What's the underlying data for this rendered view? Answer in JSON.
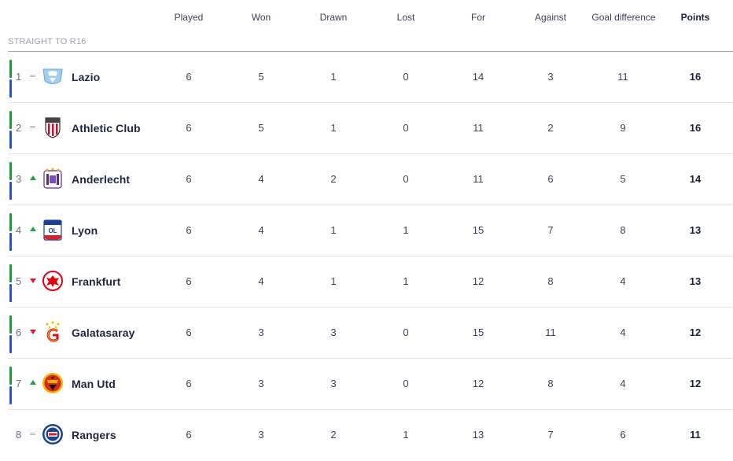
{
  "headers": {
    "played": "Played",
    "won": "Won",
    "drawn": "Drawn",
    "lost": "Lost",
    "for": "For",
    "against": "Against",
    "goal_difference": "Goal difference",
    "points": "Points"
  },
  "section_label": "STRAIGHT TO R16",
  "rows": [
    {
      "pos": "1",
      "move": "same",
      "team": "Lazio",
      "crest": "lazio-crest-icon",
      "played": "6",
      "won": "5",
      "drawn": "1",
      "lost": "0",
      "for": "14",
      "against": "3",
      "gd": "11",
      "points": "16"
    },
    {
      "pos": "2",
      "move": "same",
      "team": "Athletic Club",
      "crest": "athletic-club-crest-icon",
      "played": "6",
      "won": "5",
      "drawn": "1",
      "lost": "0",
      "for": "11",
      "against": "2",
      "gd": "9",
      "points": "16"
    },
    {
      "pos": "3",
      "move": "up",
      "team": "Anderlecht",
      "crest": "anderlecht-crest-icon",
      "played": "6",
      "won": "4",
      "drawn": "2",
      "lost": "0",
      "for": "11",
      "against": "6",
      "gd": "5",
      "points": "14"
    },
    {
      "pos": "4",
      "move": "up",
      "team": "Lyon",
      "crest": "lyon-crest-icon",
      "played": "6",
      "won": "4",
      "drawn": "1",
      "lost": "1",
      "for": "15",
      "against": "7",
      "gd": "8",
      "points": "13"
    },
    {
      "pos": "5",
      "move": "down",
      "team": "Frankfurt",
      "crest": "frankfurt-crest-icon",
      "played": "6",
      "won": "4",
      "drawn": "1",
      "lost": "1",
      "for": "12",
      "against": "8",
      "gd": "4",
      "points": "13"
    },
    {
      "pos": "6",
      "move": "down",
      "team": "Galatasaray",
      "crest": "galatasaray-crest-icon",
      "played": "6",
      "won": "3",
      "drawn": "3",
      "lost": "0",
      "for": "15",
      "against": "11",
      "gd": "4",
      "points": "12"
    },
    {
      "pos": "7",
      "move": "up",
      "team": "Man Utd",
      "crest": "man-utd-crest-icon",
      "played": "6",
      "won": "3",
      "drawn": "3",
      "lost": "0",
      "for": "12",
      "against": "8",
      "gd": "4",
      "points": "12"
    },
    {
      "pos": "8",
      "move": "same",
      "team": "Rangers",
      "crest": "rangers-crest-icon",
      "played": "6",
      "won": "3",
      "drawn": "2",
      "lost": "1",
      "for": "13",
      "against": "7",
      "gd": "6",
      "points": "11"
    }
  ],
  "colors": {
    "qualify_green": "#1f9d3a",
    "qualify_blue": "#2a54c7",
    "up_green": "#24a03f",
    "down_red": "#d6202a"
  }
}
